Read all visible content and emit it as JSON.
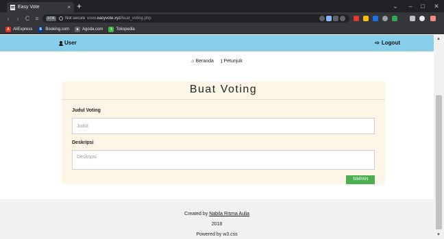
{
  "browser": {
    "tab_title": "Easy Vote",
    "tab_close": "×",
    "new_tab": "+",
    "window_controls": {
      "tabsearch": "⌄",
      "minimize": "–",
      "maximize": "□",
      "close": "✕"
    },
    "nav": {
      "back": "‹",
      "forward": "›",
      "reload": "C"
    },
    "address": {
      "chip": "STIK",
      "status": "Not secure",
      "url_prefix": "www.",
      "url_domain": "easyvote.xyz",
      "url_path": "/buat_voting.php"
    },
    "bookmarks": [
      {
        "label": "AliExpress",
        "icon": "A",
        "color": "#e43225"
      },
      {
        "label": "Booking.com",
        "icon": "B",
        "color": "#003b95"
      },
      {
        "label": "Agoda.com",
        "icon": "a",
        "color": "#5f6368"
      },
      {
        "label": "Tokopedia",
        "icon": "t",
        "color": "#42b549"
      }
    ]
  },
  "header": {
    "user_label": "User",
    "logout_label": "Logout",
    "background": "#87ceeb"
  },
  "subnav": {
    "home_label": "Beranda",
    "guide_label": "Petunjuk"
  },
  "form": {
    "title": "Buat Voting",
    "title_label": "Judul Voting",
    "title_placeholder": "Judul",
    "title_value": "",
    "description_label": "Deskripsi",
    "description_placeholder": "Deskripsi",
    "description_value": "",
    "submit_label": "SIMPAN",
    "card_background": "#fdf6e6",
    "submit_color": "#4caf50"
  },
  "footer": {
    "created_by_prefix": "Created by",
    "author": "Nabila Risma Aulia",
    "year": "2018",
    "powered_by": "Powered by w3.css"
  }
}
